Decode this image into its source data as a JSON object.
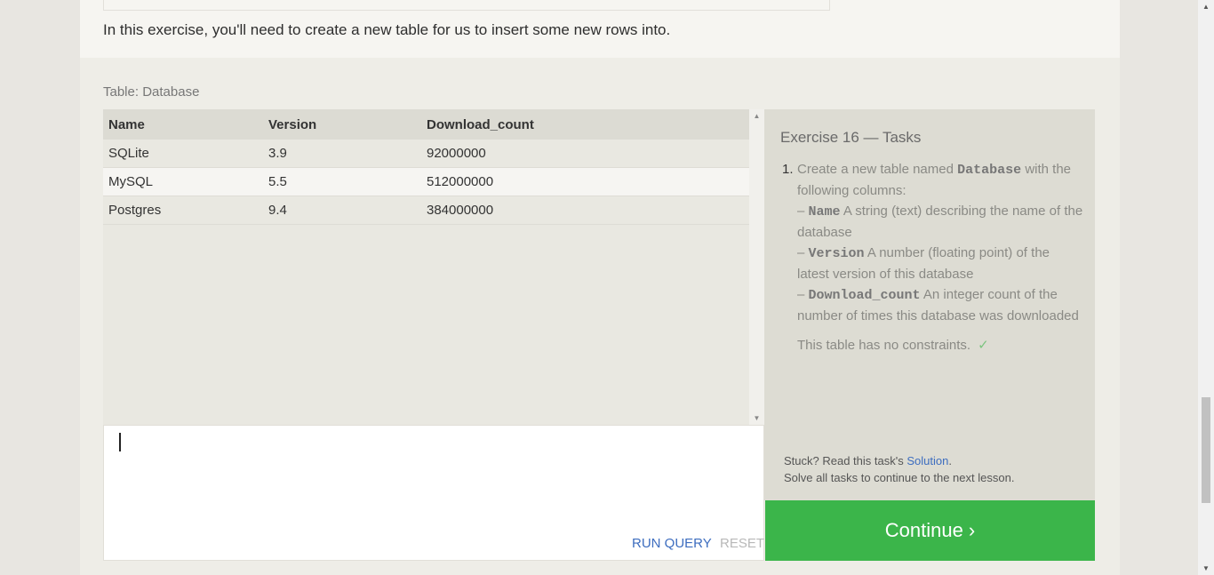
{
  "intro_text": "In this exercise, you'll need to create a new table for us to insert some new rows into.",
  "table_caption": "Table: Database",
  "result_table": {
    "headers": [
      "Name",
      "Version",
      "Download_count"
    ],
    "rows": [
      [
        "SQLite",
        "3.9",
        "92000000"
      ],
      [
        "MySQL",
        "5.5",
        "512000000"
      ],
      [
        "Postgres",
        "9.4",
        "384000000"
      ]
    ]
  },
  "editor": {
    "value": "",
    "run_label": "RUN QUERY",
    "reset_label": "RESET"
  },
  "tasks": {
    "title": "Exercise 16 — Tasks",
    "number": "1.",
    "intro_prefix": "Create a new table named",
    "table_name": "Database",
    "intro_suffix": "with the following columns:",
    "columns": [
      {
        "name": "Name",
        "desc": "A string (text) describing the name of the database"
      },
      {
        "name": "Version",
        "desc": "A number (floating point) of the latest version of this database"
      },
      {
        "name": "Download_count",
        "desc": "An integer count of the number of times this database was downloaded"
      }
    ],
    "dash": "–",
    "constraints_text": "This table has no constraints.",
    "check_icon": "checkmark-icon"
  },
  "help": {
    "stuck_prefix": "Stuck? Read this task's",
    "solution_link": "Solution",
    "stuck_suffix": ".",
    "continue_note": "Solve all tasks to continue to the next lesson."
  },
  "continue_label": "Continue ›",
  "colors": {
    "accent_green": "#3bb54a",
    "link_blue": "#3d6dbf",
    "check_green": "#7bc47f"
  }
}
